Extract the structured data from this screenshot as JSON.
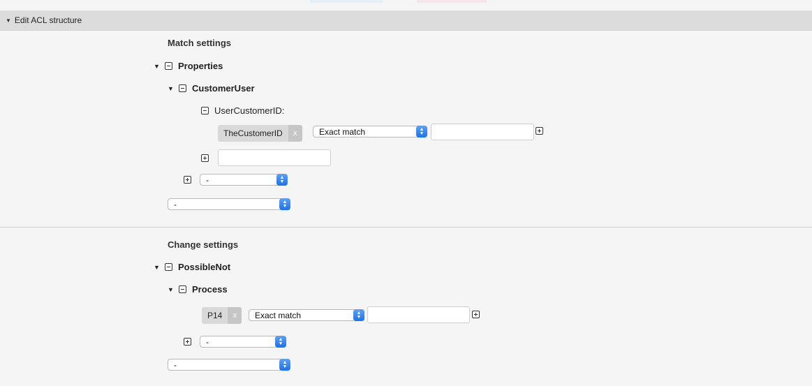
{
  "header": {
    "title": "Edit ACL structure"
  },
  "match": {
    "section_title": "Match settings",
    "properties_label": "Properties",
    "customer_user_label": "CustomerUser",
    "user_customer_id_label": "UserCustomerID:",
    "tag_value": "TheCustomerID",
    "tag_remove": "x",
    "match_type": "Exact match",
    "attr_select": "-",
    "section_select": "-"
  },
  "change": {
    "section_title": "Change settings",
    "possible_not_label": "PossibleNot",
    "process_label": "Process",
    "tag_value": "P14",
    "tag_remove": "x",
    "match_type": "Exact match",
    "attr_select": "-",
    "section_select": "-"
  },
  "icons": {
    "expand": "triangle-down-icon",
    "collapse": "minus-box-icon",
    "add": "plus-box-icon",
    "select_arrow": "updown-arrow-icon"
  },
  "colors": {
    "accent": "#2f7ff5",
    "header_bg": "#dcdcdc",
    "page_bg": "#f5f5f5"
  }
}
